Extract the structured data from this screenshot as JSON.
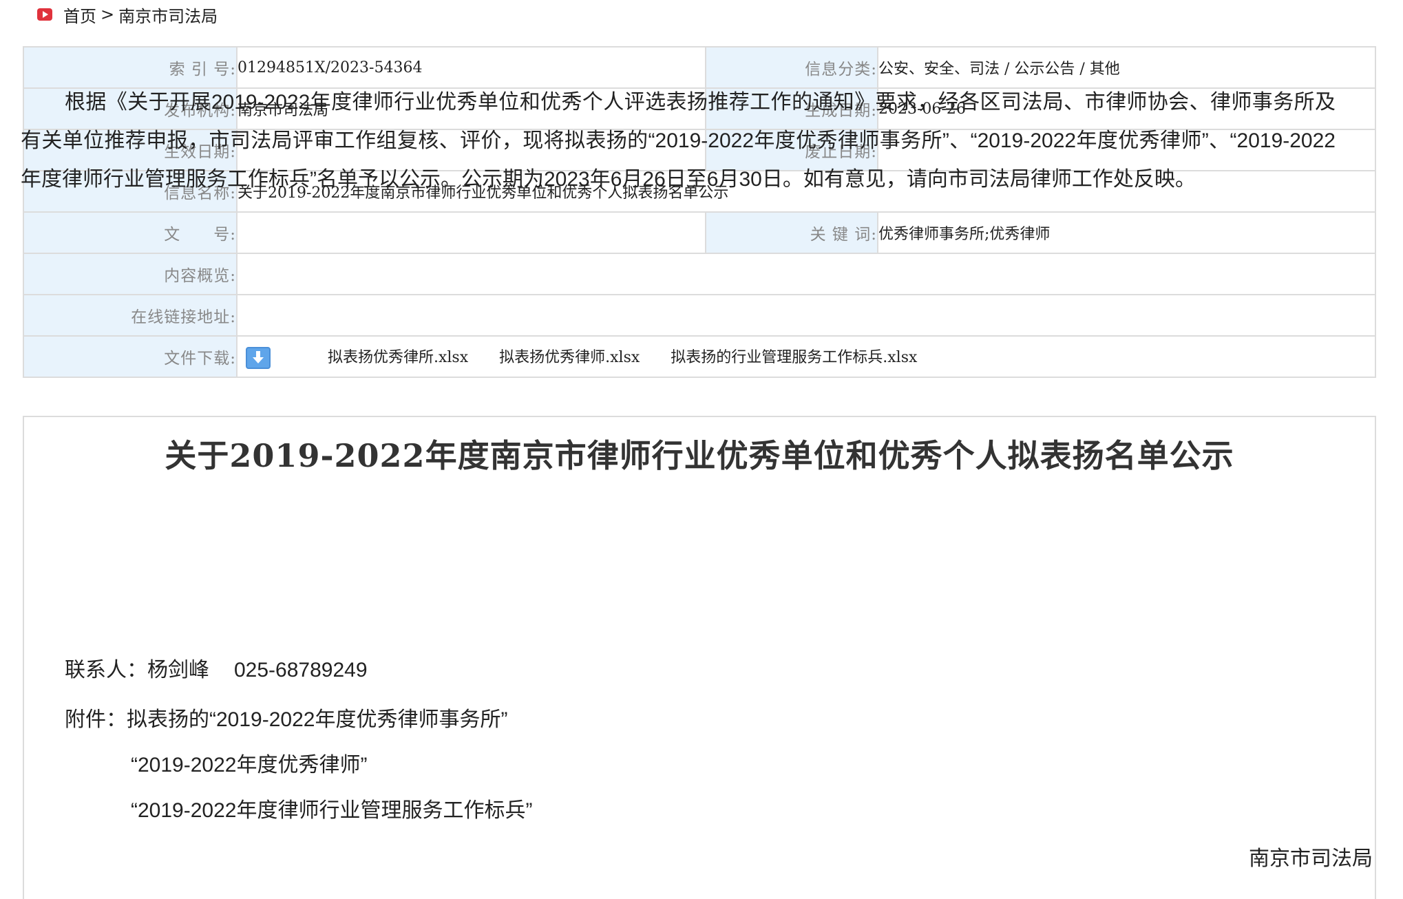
{
  "breadcrumb": {
    "home": "首页",
    "separator": ">",
    "current": "南京市司法局"
  },
  "meta": {
    "index_label": "索 引 号:",
    "index_value": "01294851X/2023-54364",
    "category_label": "信息分类:",
    "category_value": "公安、安全、司法 / 公示公告 / 其他",
    "publisher_label": "发布机构:",
    "publisher_value": "南京市司法局",
    "created_label": "生成日期:",
    "created_value": "2023-06-26",
    "effective_label": "生效日期:",
    "effective_value": "",
    "expiry_label": "废止日期:",
    "expiry_value": "",
    "name_label": "信息名称:",
    "name_value": "关于2019-2022年度南京市律师行业优秀单位和优秀个人拟表扬名单公示",
    "docno_label": "文　　号:",
    "docno_value": "",
    "keywords_label": "关 键 词:",
    "keywords_value": "优秀律师事务所;优秀律师",
    "summary_label": "内容概览:",
    "summary_value": "",
    "link_label": "在线链接地址:",
    "link_value": "",
    "download_label": "文件下载:",
    "files": [
      "拟表扬优秀律所.xlsx",
      "拟表扬优秀律师.xlsx",
      "拟表扬的行业管理服务工作标兵.xlsx"
    ]
  },
  "article": {
    "title": "关于2019-2022年度南京市律师行业优秀单位和优秀个人拟表扬名单公示",
    "paragraph": "根据《关于开展2019-2022年度律师行业优秀单位和优秀个人评选表扬推荐工作的通知》要求，经各区司法局、市律师协会、律师事务所及有关单位推荐申报，市司法局评审工作组复核、评价，现将拟表扬的“2019-2022年度优秀律师事务所”、“2019-2022年度优秀律师”、“2019-2022年度律师行业管理服务工作标兵”名单予以公示。公示期为2023年6月26日至6月30日。如有意见，请向市司法局律师工作处反映。",
    "contact_label": "联系人：杨剑峰",
    "contact_phone": "025-68789249",
    "attachment_label": "附件：",
    "attachments": [
      "拟表扬的“2019-2022年度优秀律师事务所”",
      "“2019-2022年度优秀律师”",
      "“2019-2022年度律师行业管理服务工作标兵”"
    ],
    "signature": "南京市司法局"
  }
}
